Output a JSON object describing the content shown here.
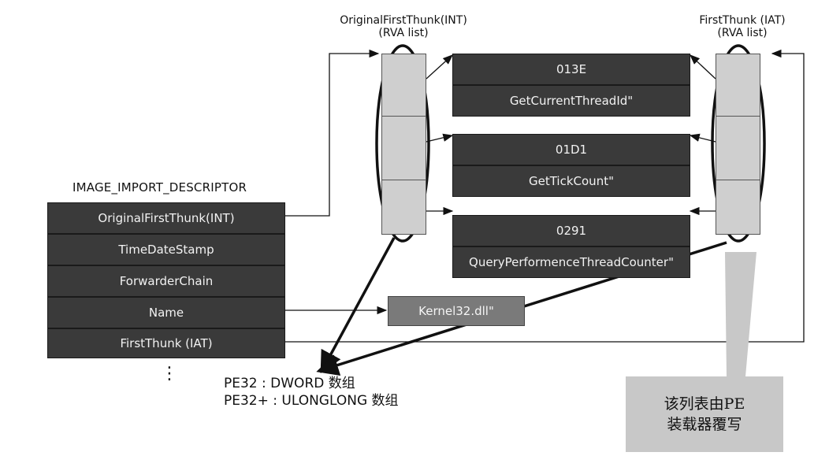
{
  "descriptor": {
    "title": "IMAGE_IMPORT_DESCRIPTOR",
    "fields": [
      "OriginalFirstThunk(INT)",
      "TimeDateStamp",
      "ForwarderChain",
      "Name",
      "FirstThunk (IAT)"
    ],
    "more_indicator": "⋮"
  },
  "int_column": {
    "title_line1": "OriginalFirstThunk(INT)",
    "title_line2": "(RVA list)"
  },
  "iat_column": {
    "title_line1": "FirstThunk (IAT)",
    "title_line2": "(RVA list)"
  },
  "import_by_name": [
    {
      "hint": "013E",
      "name": "GetCurrentThreadId\""
    },
    {
      "hint": "01D1",
      "name": "GetTickCount\""
    },
    {
      "hint": "0291",
      "name": "QueryPerformenceThreadCounter\""
    }
  ],
  "dll_name": "Kernel32.dll\"",
  "note": {
    "line1": "PE32  : DWORD 数组",
    "line2": "PE32+ : ULONGLONG 数组"
  },
  "callout": {
    "line1": "该列表由PE",
    "line2": "装载器覆写"
  }
}
